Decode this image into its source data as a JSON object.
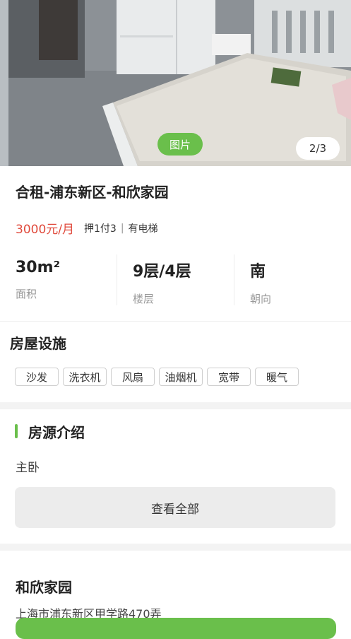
{
  "photo": {
    "tag_label": "图片",
    "counter": "2/3"
  },
  "listing": {
    "title": "合租-浦东新区-和欣家园",
    "price": "3000元/月",
    "deposit": "押1付3",
    "separator": "|",
    "elevator": "有电梯"
  },
  "stats": [
    {
      "value": "30m²",
      "label": "面积"
    },
    {
      "value": "9层/4层",
      "label": "楼层"
    },
    {
      "value": "南",
      "label": "朝向"
    }
  ],
  "facilities": {
    "title": "房屋设施",
    "items": [
      "沙发",
      "洗衣机",
      "风扇",
      "油烟机",
      "宽带",
      "暖气"
    ]
  },
  "intro": {
    "title": "房源介绍",
    "text": "主卧",
    "view_all": "查看全部"
  },
  "estate": {
    "name": "和欣家园",
    "address": "上海市浦东新区甲学路470弄"
  },
  "colors": {
    "accent": "#6abf4b",
    "price": "#e04a3c"
  }
}
